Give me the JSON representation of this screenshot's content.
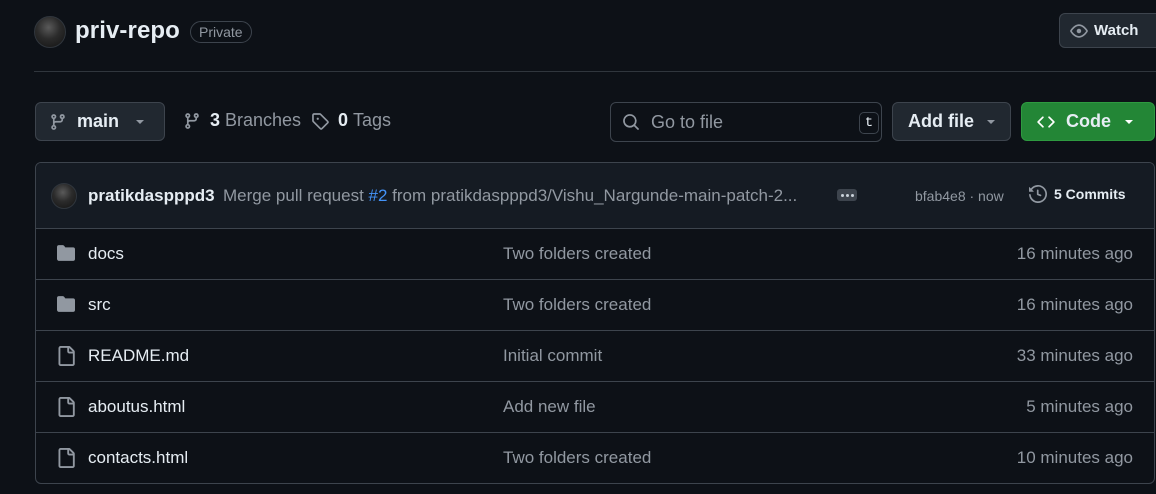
{
  "repo": {
    "name": "priv-repo",
    "visibility": "Private"
  },
  "header": {
    "watch_label": "Watch"
  },
  "toolbar": {
    "branch": "main",
    "branches_count": "3",
    "branches_label": "Branches",
    "tags_count": "0",
    "tags_label": "Tags",
    "search_placeholder": "Go to file",
    "search_shortcut": "t",
    "add_file_label": "Add file",
    "code_label": "Code"
  },
  "commit": {
    "author": "pratikdaspppd3",
    "message_prefix": "Merge pull request ",
    "pr_number": "#2",
    "message_suffix": " from pratikdaspppd3/Vishu_Nargunde-main-patch-2...",
    "sha_time": "bfab4e8 · now",
    "commits_label": "5 Commits"
  },
  "files": [
    {
      "type": "folder",
      "name": "docs",
      "message": "Two folders created",
      "time": "16 minutes ago"
    },
    {
      "type": "folder",
      "name": "src",
      "message": "Two folders created",
      "time": "16 minutes ago"
    },
    {
      "type": "file",
      "name": "README.md",
      "message": "Initial commit",
      "time": "33 minutes ago"
    },
    {
      "type": "file",
      "name": "aboutus.html",
      "message": "Add new file",
      "time": "5 minutes ago"
    },
    {
      "type": "file",
      "name": "contacts.html",
      "message": "Two folders created",
      "time": "10 minutes ago"
    }
  ],
  "colors": {
    "background": "#0d1117",
    "border": "#3d444d",
    "code_button": "#238636",
    "link": "#4493f8",
    "muted_text": "#9198a1"
  }
}
